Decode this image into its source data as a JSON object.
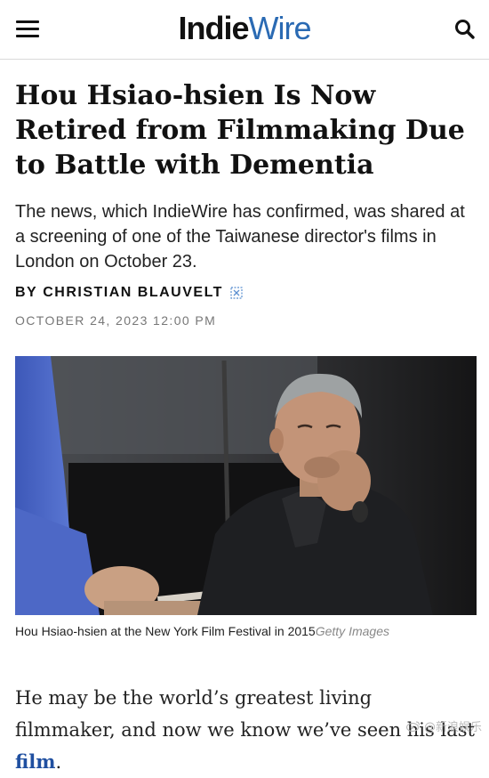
{
  "header": {
    "logo_bold": "Indie",
    "logo_light": "Wire",
    "menu_icon": "hamburger-menu-icon",
    "search_icon": "search-icon",
    "brand_color": "#2a6ab3"
  },
  "article": {
    "headline": "Hou Hsiao-hsien Is Now Retired from Filmmaking Due to Battle with Dementia",
    "dek": "The news, which IndieWire has confirmed, was shared at a screening of one of the Taiwanese director's films in London on October 23.",
    "byline_prefix": "BY",
    "author": "CHRISTIAN BLAUVELT",
    "author_icon": "author-expand-icon",
    "date": "OCTOBER 24, 2023 12:00 PM",
    "caption": "Hou Hsiao-hsien at the New York Film Festival in 2015",
    "caption_credit": "Getty Images",
    "body_before_link": "He may be the world’s greatest living filmmaker, and now we know we’ve seen his last ",
    "body_link": "film",
    "body_after_link": "."
  },
  "watermark": {
    "text": "@新浪娱乐",
    "icon": "weibo-logo-icon"
  }
}
